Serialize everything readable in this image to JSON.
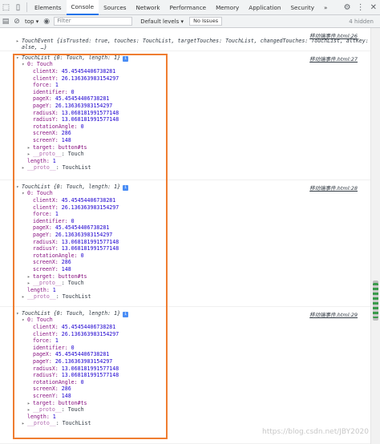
{
  "devtools": {
    "tabs": [
      "Elements",
      "Console",
      "Sources",
      "Network",
      "Performance",
      "Memory",
      "Application",
      "Security"
    ],
    "active_tab": "Console",
    "more_tabs": "»"
  },
  "toolbar": {
    "context": "top",
    "filter_placeholder": "Filter",
    "levels": "Default levels ▾",
    "no_issues": "No Issues",
    "hidden": "4 hidden"
  },
  "console": {
    "touch_event": {
      "text1": "TouchEvent {isTrusted: true, touches: TouchList, targetTouches: TouchList, changedTouches: TouchList, altKey: f",
      "text2": "alse, …}",
      "source": "移动端事件.html:26"
    },
    "groups": [
      {
        "source": "移动端事件.html:27",
        "header": "TouchList {0: Touch, length: 1}",
        "item0": "0: Touch",
        "clientX": "45.45454406738281",
        "clientY": "26.136363983154297",
        "force": "1",
        "identifier": "0",
        "pageX": "45.45454406738281",
        "pageY": "26.136363983154297",
        "radiusX": "13.068181991577148",
        "radiusY": "13.068181991577148",
        "rotationAngle": "0",
        "screenX": "286",
        "screenY": "148",
        "target": "button#ts",
        "proto_inner": "Touch",
        "length": "1",
        "proto_outer": "TouchList"
      },
      {
        "source": "移动端事件.html:28",
        "header": "TouchList {0: Touch, length: 1}",
        "item0": "0: Touch",
        "clientX": "45.45454406738281",
        "clientY": "26.136363983154297",
        "force": "1",
        "identifier": "0",
        "pageX": "45.45454406738281",
        "pageY": "26.136363983154297",
        "radiusX": "13.068181991577148",
        "radiusY": "13.068181991577148",
        "rotationAngle": "0",
        "screenX": "286",
        "screenY": "148",
        "target": "button#ts",
        "proto_inner": "Touch",
        "length": "1",
        "proto_outer": "TouchList"
      },
      {
        "source": "移动端事件.html:29",
        "header": "TouchList {0: Touch, length: 1}",
        "item0": "0: Touch",
        "clientX": "45.45454406738281",
        "clientY": "26.136363983154297",
        "force": "1",
        "identifier": "0",
        "pageX": "45.45454406738281",
        "pageY": "26.136363983154297",
        "radiusX": "13.068181991577148",
        "radiusY": "13.068181991577148",
        "rotationAngle": "0",
        "screenX": "286",
        "screenY": "148",
        "target": "button#ts",
        "proto_inner": "Touch",
        "length": "1",
        "proto_outer": "TouchList"
      }
    ]
  },
  "watermark": "https://blog.csdn.net/JBY2020",
  "colors": {
    "highlight_box": "#ef7d31",
    "accent": "#1a73e8"
  },
  "icons": [
    "inspect-icon",
    "device-toggle-icon",
    "sidebar-icon",
    "clear-console-icon",
    "eye-icon",
    "gear-icon",
    "more-menu-icon",
    "close-icon"
  ]
}
